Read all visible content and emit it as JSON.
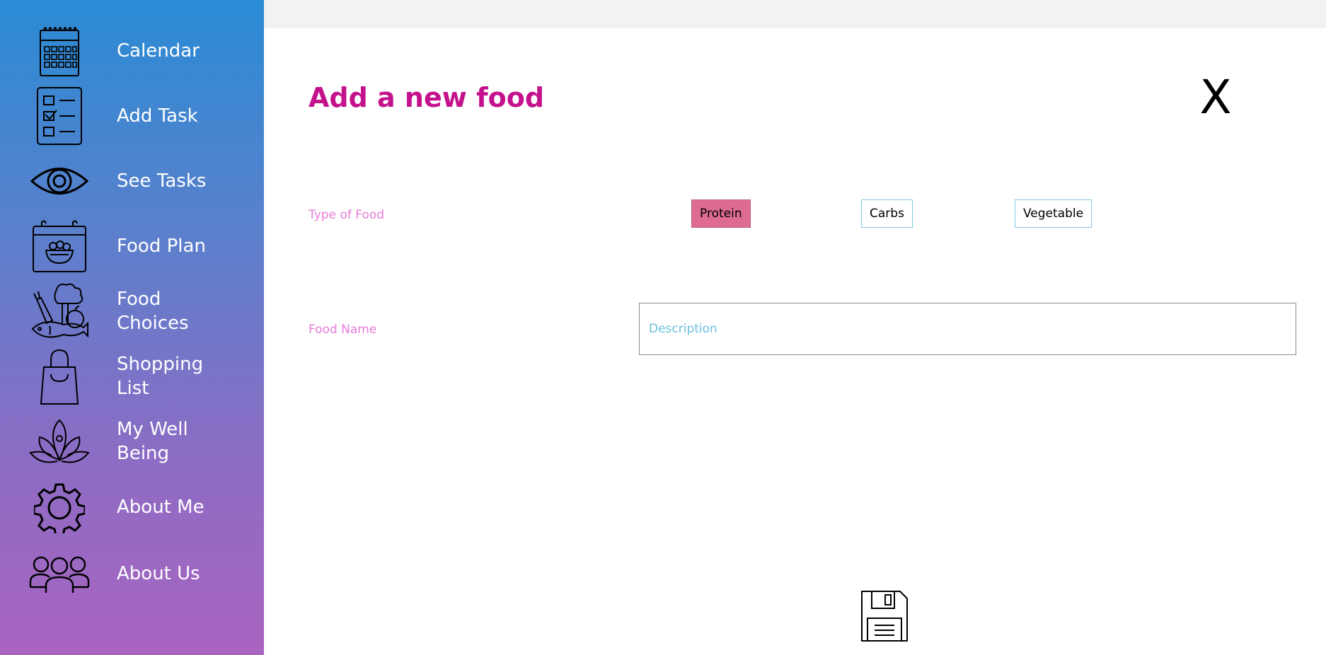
{
  "sidebar": {
    "items": [
      {
        "label": "Calendar",
        "icon": "calendar-icon"
      },
      {
        "label": "Add Task",
        "icon": "checklist-icon"
      },
      {
        "label": "See Tasks",
        "icon": "eye-icon"
      },
      {
        "label": "Food Plan",
        "icon": "food-plan-icon"
      },
      {
        "label": "Food Choices",
        "icon": "food-choices-icon"
      },
      {
        "label": "Shopping List",
        "icon": "shopping-bag-icon"
      },
      {
        "label": "My Well Being",
        "icon": "lotus-icon"
      },
      {
        "label": "About Me",
        "icon": "gear-icon"
      },
      {
        "label": "About Us",
        "icon": "group-icon"
      }
    ],
    "gradient_top": "#2a8bd4",
    "gradient_bottom": "#a964c0"
  },
  "form": {
    "title": "Add a new food",
    "close_label": "X",
    "type_label": "Type of Food",
    "type_options": [
      {
        "label": "Protein",
        "selected": true
      },
      {
        "label": "Carbs",
        "selected": false
      },
      {
        "label": "Vegetable",
        "selected": false
      }
    ],
    "name_label": "Food Name",
    "description_placeholder": "Description",
    "description_value": "",
    "save_icon": "save-icon"
  },
  "colors": {
    "title": "#c4128c",
    "field_label": "#e67ad8",
    "selected_option": "#dd6b93",
    "option_border": "#7ec8e6"
  }
}
